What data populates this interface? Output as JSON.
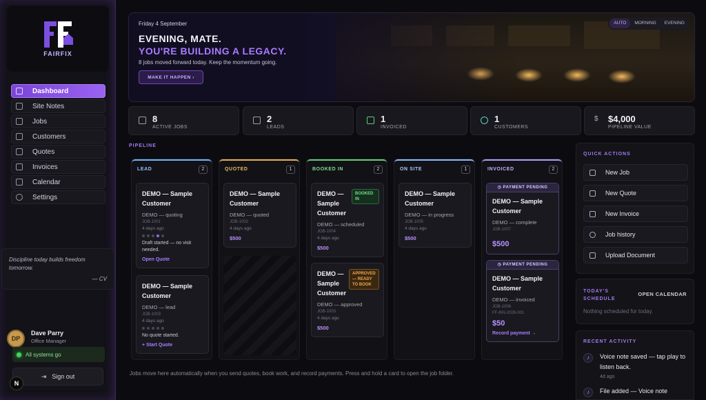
{
  "brand": {
    "name": "FAIRFIX"
  },
  "sidebar": {
    "items": [
      {
        "label": "Dashboard"
      },
      {
        "label": "Site Notes"
      },
      {
        "label": "Jobs"
      },
      {
        "label": "Customers"
      },
      {
        "label": "Quotes"
      },
      {
        "label": "Invoices"
      },
      {
        "label": "Calendar"
      },
      {
        "label": "Settings"
      }
    ],
    "quote": {
      "text": "Discipline today builds freedom tomorrow.",
      "author": "— CV"
    },
    "user": {
      "initials": "DP",
      "name": "Dave Parry",
      "role": "Office Manager"
    },
    "status": "All systems go",
    "signout": "Sign out",
    "badge": "N"
  },
  "hero": {
    "date": "Friday 4 September",
    "greeting": "EVENING, MATE.",
    "tagline": "YOU'RE BUILDING A LEGACY.",
    "subtitle": "8 jobs moved forward today. Keep the momentum going.",
    "cta": "MAKE IT HAPPEN  ›",
    "modes": [
      "AUTO",
      "MORNING",
      "EVENING"
    ],
    "active_mode": "AUTO"
  },
  "stats": [
    {
      "value": "8",
      "label": "ACTIVE JOBS"
    },
    {
      "value": "2",
      "label": "LEADS"
    },
    {
      "value": "1",
      "label": "INVOICED"
    },
    {
      "value": "1",
      "label": "CUSTOMERS"
    },
    {
      "value": "$4,000",
      "label": "PIPELINE VALUE"
    }
  ],
  "pipeline": {
    "title": "PIPELINE",
    "columns": [
      {
        "name": "LEAD",
        "count": "2",
        "color": "#6fb6ff"
      },
      {
        "name": "QUOTED",
        "count": "1",
        "color": "#e0b24a"
      },
      {
        "name": "BOOKED IN",
        "count": "2",
        "color": "#5fd07a"
      },
      {
        "name": "ON SITE",
        "count": "1",
        "color": "#8fb8ff"
      },
      {
        "name": "INVOICED",
        "count": "2",
        "color": "#b49aff"
      }
    ],
    "cards": {
      "lead1": {
        "title": "DEMO — Sample Customer",
        "status": "DEMO — quoting",
        "job": "JOB-1001",
        "age": "4 days ago",
        "note": "Draft started — no visit needed.",
        "link": "Open Quote"
      },
      "lead2": {
        "title": "DEMO — Sample Customer",
        "status": "DEMO — lead",
        "job": "JOB-1003",
        "age": "4 days ago",
        "note": "No quote started.",
        "link": "+ Start Quote"
      },
      "quoted1": {
        "title": "DEMO — Sample Customer",
        "status": "DEMO — quoted",
        "job": "JOB-1002",
        "age": "4 days ago",
        "amount": "$500"
      },
      "booked1": {
        "title": "DEMO — Sample Customer",
        "tag": "BOOKED IN",
        "status": "DEMO — scheduled",
        "job": "JOB-1004",
        "age": "4 days ago",
        "amount": "$500"
      },
      "booked2": {
        "title": "DEMO — Sample Customer",
        "tag": "APPROVED — READY TO BOOK",
        "status": "DEMO — approved",
        "job": "JOB-1003",
        "age": "4 days ago",
        "amount": "$500"
      },
      "onsite1": {
        "title": "DEMO — Sample Customer",
        "status": "DEMO — in progress",
        "job": "JOB-1005",
        "age": "4 days ago",
        "amount": "$500"
      },
      "inv1": {
        "badge": "PAYMENT PENDING",
        "title": "DEMO — Sample Customer",
        "status": "DEMO — complete",
        "job": "JOB-1007",
        "amount": "$500"
      },
      "inv2": {
        "badge": "PAYMENT PENDING",
        "title": "DEMO — Sample Customer",
        "status": "DEMO — invoiced",
        "job": "JOB-1006",
        "ref": "FF-INV-2026-001",
        "amount": "$50",
        "link": "Record payment →"
      }
    },
    "footnote": "Jobs move here automatically when you send quotes, book work, and record payments. Press and hold a card to open the job folder."
  },
  "quick_actions": {
    "title": "QUICK ACTIONS",
    "items": [
      {
        "label": "New Job"
      },
      {
        "label": "New Quote"
      },
      {
        "label": "New Invoice"
      },
      {
        "label": "Job history"
      },
      {
        "label": "Upload Document"
      }
    ]
  },
  "schedule": {
    "title": "TODAY'S SCHEDULE",
    "open_label": "OPEN CALENDAR",
    "empty": "Nothing scheduled for today."
  },
  "activity": {
    "title": "RECENT ACTIVITY",
    "items": [
      {
        "text": "Voice note saved — tap play to listen back.",
        "time": "4d ago"
      },
      {
        "text": "File added — Voice note",
        "time": ""
      }
    ]
  },
  "colors": {
    "accent": "#9a62f0",
    "success": "#3fd45a",
    "warning": "#f0a64a"
  }
}
